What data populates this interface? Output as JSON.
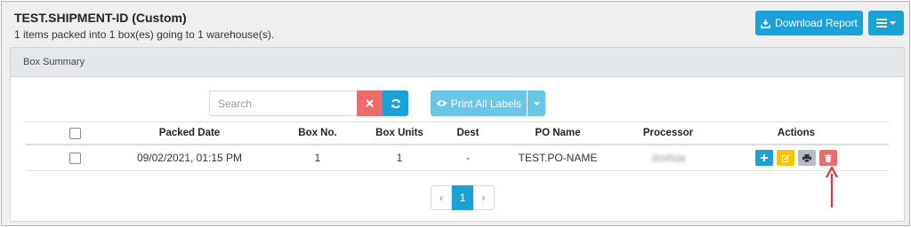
{
  "header": {
    "title": "TEST.SHIPMENT-ID (Custom)",
    "subtitle": "1 items packed into 1 box(es) going to 1 warehouse(s).",
    "download_label": "Download Report"
  },
  "panel": {
    "title": "Box Summary"
  },
  "toolbar": {
    "search_placeholder": "Search",
    "print_all_label": "Print All Labels"
  },
  "table": {
    "columns": [
      "Packed Date",
      "Box No.",
      "Box Units",
      "Dest",
      "PO Name",
      "Processor",
      "Actions"
    ],
    "rows": [
      {
        "packed_date": "09/02/2021, 01:15 PM",
        "box_no": "1",
        "box_units": "1",
        "dest": "-",
        "po_name": "TEST.PO-NAME",
        "processor": "Joshua"
      }
    ]
  },
  "pagination": {
    "prev": "‹",
    "current": "1",
    "next": "›"
  },
  "colors": {
    "primary": "#1aa1d6",
    "danger": "#f06a6a",
    "warning": "#f7c200",
    "muted": "#b6bcc3",
    "annotation_arrow": "#e0313b"
  }
}
